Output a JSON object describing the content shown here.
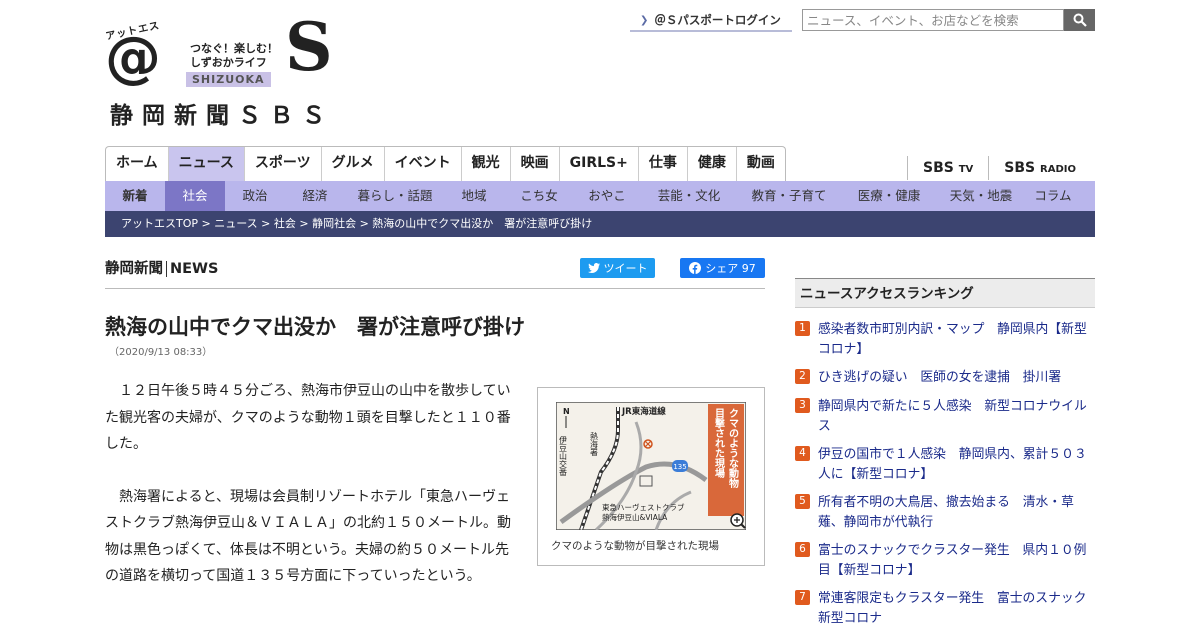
{
  "logo": {
    "at_small": "アットエス",
    "at_mark": "@",
    "tagline_line1": "つなぐ！楽しむ！",
    "tagline_line2": "しずおかライフ",
    "shizuoka": "SHIZUOKA",
    "s_mark": "S",
    "name": "静岡新聞ＳＢＳ"
  },
  "header": {
    "passport_label": "＠Ｓパスポートログイン",
    "search_placeholder": "ニュース、イベント、お店などを検索"
  },
  "main_nav": [
    "ホーム",
    "ニュース",
    "スポーツ",
    "グルメ",
    "イベント",
    "観光",
    "映画",
    "GIRLS+",
    "仕事",
    "健康",
    "動画"
  ],
  "sbs_links": {
    "tv_main": "SBS",
    "tv_sub": "TV",
    "radio_main": "SBS",
    "radio_sub": "RADIO"
  },
  "sub_nav": [
    "新着",
    "社会",
    "政治",
    "経済",
    "暮らし・話題",
    "地域",
    "こち女",
    "おやこ",
    "芸能・文化",
    "教育・子育て",
    "医療・健康",
    "天気・地震",
    "コラム"
  ],
  "breadcrumb": "アットエスTOP > ニュース > 社会 > 静岡社会 > 熱海の山中でクマ出没か　署が注意呼び掛け",
  "article": {
    "source_main": "静岡新聞",
    "source_sub": "NEWS",
    "tweet_label": "ツイート",
    "share_label": "シェア 97",
    "title": "熱海の山中でクマ出没か　署が注意呼び掛け",
    "date": "（2020/9/13 08:33）",
    "paragraph1": "１２日午後５時４５分ごろ、熱海市伊豆山の山中を散歩していた観光客の夫婦が、クマのような動物１頭を目撃したと１１０番した。",
    "paragraph2": "熱海署によると、現場は会員制リゾートホテル「東急ハーヴェストクラブ熱海伊豆山＆ＶＩＡＬＡ」の北約１５０メートル。動物は黒色っぽくて、体長は不明という。夫婦の約５０メートル先の道路を横切って国道１３５号方面に下っていったという。"
  },
  "figure": {
    "caption": "クマのような動物が目撃された現場",
    "map_north": "N",
    "map_rail": "JR東海道線",
    "map_police": "熱海署",
    "map_junction": "伊豆山交番",
    "map_route": "135",
    "map_hotel_1": "東急ハーヴェストクラブ",
    "map_hotel_2": "熱海伊豆山&VIALA",
    "map_banner_1": "クマのような動物",
    "map_banner_2": "目撃された現場"
  },
  "ranking": {
    "heading": "ニュースアクセスランキング",
    "items": [
      {
        "num": "1",
        "text": "感染者数市町別内訳・マップ　静岡県内【新型コロナ】"
      },
      {
        "num": "2",
        "text": "ひき逃げの疑い　医師の女を逮捕　掛川署"
      },
      {
        "num": "3",
        "text": "静岡県内で新たに５人感染　新型コロナウイルス"
      },
      {
        "num": "4",
        "text": "伊豆の国市で１人感染　静岡県内、累計５０３人に【新型コロナ】"
      },
      {
        "num": "5",
        "text": "所有者不明の大鳥居、撤去始まる　清水・草薙、静岡市が代執行"
      },
      {
        "num": "6",
        "text": "富士のスナックでクラスター発生　県内１０例目【新型コロナ】"
      },
      {
        "num": "7",
        "text": "常連客限定もクラスター発生　富士のスナック　新型コロナ"
      }
    ]
  },
  "colors": {
    "nav_active": "#c9c5ee",
    "subnav_bg": "#b9b6ec",
    "subnav_active": "#7c76c6",
    "breadcrumb_bg": "#3c4470",
    "rank_badge": "#e05a1e",
    "link": "#1a2a8a"
  }
}
